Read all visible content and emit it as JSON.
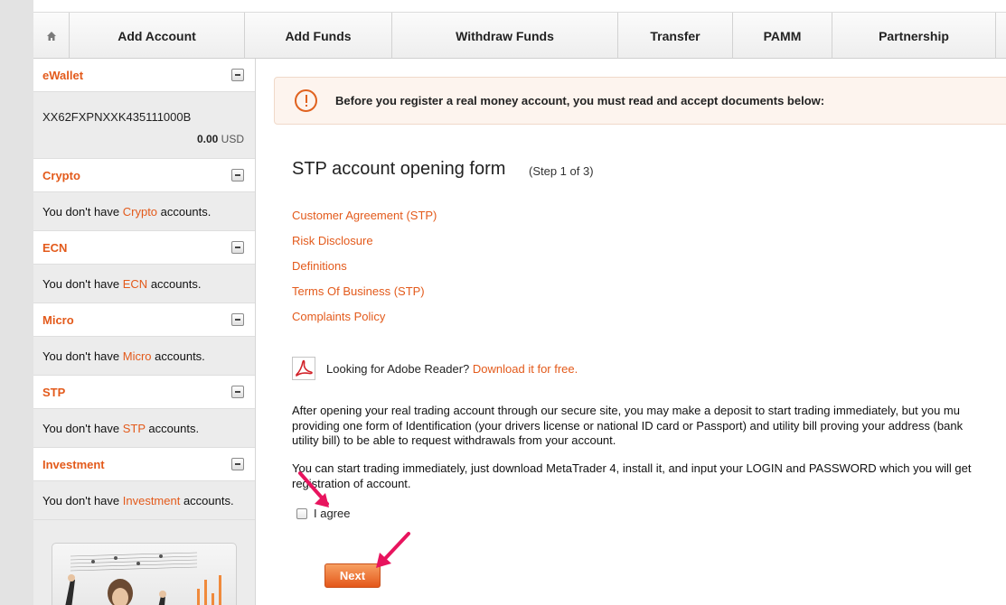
{
  "nav": {
    "items": [
      {
        "label": "Add Account"
      },
      {
        "label": "Add Funds"
      },
      {
        "label": "Withdraw Funds"
      },
      {
        "label": "Transfer"
      },
      {
        "label": "PAMM"
      },
      {
        "label": "Partnership"
      }
    ],
    "home_icon": "home-icon"
  },
  "sidebar": {
    "ewallet": {
      "title": "eWallet",
      "account_id": "XX62FXPNXXK435111000B",
      "balance": "0.00",
      "currency": "USD"
    },
    "sections": [
      {
        "title": "Crypto",
        "prefix": "You don't have ",
        "type": "Crypto",
        "suffix": " accounts."
      },
      {
        "title": "ECN",
        "prefix": "You don't have ",
        "type": "ECN",
        "suffix": " accounts."
      },
      {
        "title": "Micro",
        "prefix": "You don't have ",
        "type": "Micro",
        "suffix": " accounts."
      },
      {
        "title": "STP",
        "prefix": "You don't have ",
        "type": "STP",
        "suffix": " accounts."
      },
      {
        "title": "Investment",
        "prefix": "You don't have ",
        "type": "Investment",
        "suffix": " accounts."
      }
    ]
  },
  "main": {
    "notice": "Before you register a real money account, you must read and accept documents below:",
    "form_title": "STP account opening form",
    "form_step": "(Step 1 of 3)",
    "documents": [
      "Customer Agreement (STP)",
      "Risk Disclosure",
      "Definitions",
      "Terms Of Business (STP)",
      "Complaints Policy"
    ],
    "reader_text": "Looking for Adobe Reader?",
    "reader_link": "Download it for free.",
    "paragraph1": [
      "After opening your real trading account through our secure site, you may make a deposit to start trading immediately, but you mu",
      "providing one form of Identification (your drivers license or national ID card or Passport) and utility bill proving your address (bank",
      "utility bill) to be able to request withdrawals from your account."
    ],
    "paragraph2": [
      "You can start trading immediately, just download MetaTrader 4, install it, and input your LOGIN and PASSWORD which you will get",
      "registration of account."
    ],
    "agree_label": "I agree",
    "next_label": "Next"
  },
  "colors": {
    "accent": "#e35a1b",
    "arrow": "#e8145e"
  }
}
